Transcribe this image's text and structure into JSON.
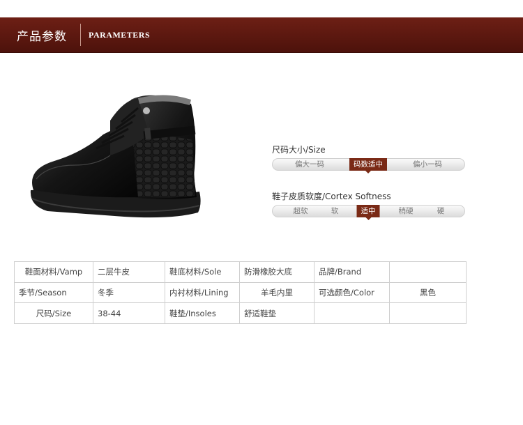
{
  "header": {
    "title_cn": "产品参数",
    "title_en": "PARAMETERS"
  },
  "size_scale": {
    "title": "尺码大小/Size",
    "options": [
      "偏大一码",
      "码数适中",
      "偏小一码"
    ],
    "selected": "码数适中"
  },
  "softness_scale": {
    "title": "鞋子皮质软度/Cortex Softness",
    "options": [
      "超软",
      "软",
      "适中",
      "稍硬",
      "硬"
    ],
    "selected": "适中"
  },
  "params_table": {
    "rows": [
      [
        "鞋面材料/Vamp",
        "二层牛皮",
        "鞋底材料/Sole",
        "防滑橡胶大底",
        "品牌/Brand",
        ""
      ],
      [
        "季节/Season",
        "冬季",
        "内衬材料/Lining",
        "羊毛内里",
        "可选颜色/Color",
        "黑色"
      ],
      [
        "尺码/Size",
        "38-44",
        "鞋垫/Insoles",
        "舒适鞋垫",
        "",
        ""
      ]
    ]
  },
  "colors": {
    "banner": "#5a170e",
    "selected": "#7a2a16"
  },
  "product_image": "black-leather-high-top-boot"
}
